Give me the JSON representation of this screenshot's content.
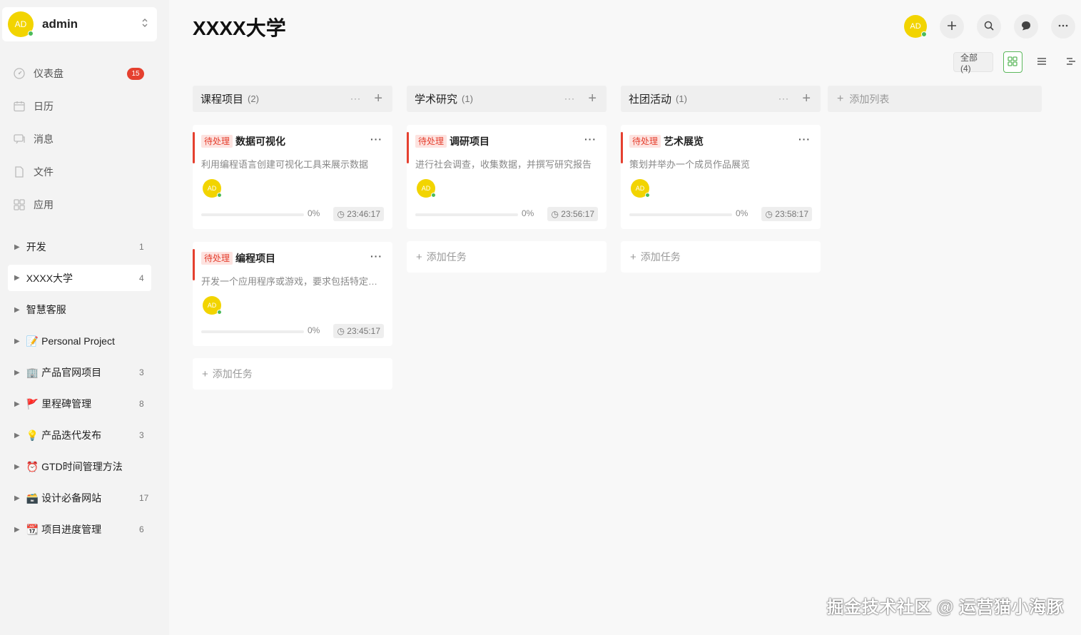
{
  "user": {
    "initials": "AD",
    "name": "admin"
  },
  "nav": [
    {
      "label": "仪表盘",
      "icon": "dashboard-icon",
      "badge": "15"
    },
    {
      "label": "日历",
      "icon": "calendar-icon"
    },
    {
      "label": "消息",
      "icon": "message-icon"
    },
    {
      "label": "文件",
      "icon": "file-icon"
    },
    {
      "label": "应用",
      "icon": "apps-icon"
    }
  ],
  "projects": [
    {
      "name": "开发",
      "emoji": "",
      "count": "1"
    },
    {
      "name": "XXXX大学",
      "emoji": "",
      "count": "4",
      "active": true
    },
    {
      "name": "智慧客服",
      "emoji": "",
      "count": ""
    },
    {
      "name": "Personal Project",
      "emoji": "📝",
      "count": ""
    },
    {
      "name": "产品官网项目",
      "emoji": "🏢",
      "count": "3"
    },
    {
      "name": "里程碑管理",
      "emoji": "🚩",
      "count": "8"
    },
    {
      "name": "产品迭代发布",
      "emoji": "💡",
      "count": "3"
    },
    {
      "name": "GTD时间管理方法",
      "emoji": "⏰",
      "count": ""
    },
    {
      "name": "设计必备网站",
      "emoji": "🗃️",
      "count": "17"
    },
    {
      "name": "项目进度管理",
      "emoji": "📆",
      "count": "6"
    }
  ],
  "page": {
    "title": "XXXX大学"
  },
  "header": {
    "avatar_initials": "AD"
  },
  "view": {
    "filter_label": "全部 (4)"
  },
  "board": {
    "columns": [
      {
        "title": "课程项目",
        "count": "(2)",
        "cards": [
          {
            "tag": "待处理",
            "title": "数据可视化",
            "desc": "利用编程语言创建可视化工具来展示数据",
            "avatar": "AD",
            "progress_pct": "0%",
            "progress": 0,
            "time": "23:46:17"
          },
          {
            "tag": "待处理",
            "title": "编程项目",
            "desc": "开发一个应用程序或游戏，要求包括特定功能",
            "avatar": "AD",
            "progress_pct": "0%",
            "progress": 0,
            "time": "23:45:17"
          }
        ],
        "add_task": "添加任务"
      },
      {
        "title": "学术研究",
        "count": "(1)",
        "cards": [
          {
            "tag": "待处理",
            "title": "调研项目",
            "desc": "进行社会调查，收集数据，并撰写研究报告",
            "avatar": "AD",
            "progress_pct": "0%",
            "progress": 0,
            "time": "23:56:17"
          }
        ],
        "add_task": "添加任务"
      },
      {
        "title": "社团活动",
        "count": "(1)",
        "cards": [
          {
            "tag": "待处理",
            "title": "艺术展览",
            "desc": "策划并举办一个成员作品展览",
            "avatar": "AD",
            "progress_pct": "0%",
            "progress": 0,
            "time": "23:58:17"
          }
        ],
        "add_task": "添加任务"
      }
    ],
    "add_list": "添加列表"
  },
  "watermark": "掘金技术社区 @ 运营猫小海豚",
  "colors": {
    "accent_red": "#e5402f",
    "avatar_yellow": "#f2d400",
    "online_green": "#4cbb5a",
    "view_active": "#5cb85c"
  }
}
